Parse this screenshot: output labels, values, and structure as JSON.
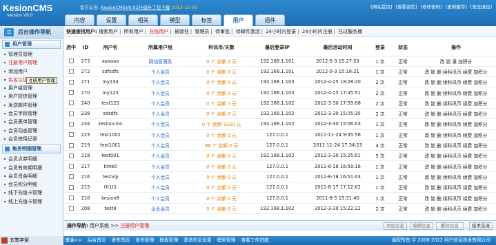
{
  "header": {
    "logo_title": "KesionCMS",
    "logo_version": "version V9.0",
    "notice_prefix": "官方公告:",
    "notice_link": "KesionCMSV9.02升级补丁包下载",
    "notice_date": "2013-12-05",
    "top_links": [
      "[网站首页]",
      "[查看留信]",
      "[修改密码]",
      "[更新缓存]",
      "[安全退出]"
    ]
  },
  "tabs": [
    {
      "label": "内容"
    },
    {
      "label": "设置"
    },
    {
      "label": "相关"
    },
    {
      "label": "模型"
    },
    {
      "label": "标签"
    },
    {
      "label": "用户",
      "active": true
    },
    {
      "label": "插件"
    }
  ],
  "sidebar": {
    "title": "后台操作导航",
    "group1": "用户管理",
    "items1": [
      {
        "label": "管理员管理"
      },
      {
        "label": "注册用户管理",
        "red": true
      },
      {
        "label": "添加用户"
      },
      {
        "label": "实名认证管理",
        "red": true
      },
      {
        "label": "用户组管理"
      },
      {
        "label": "用户短信管理"
      },
      {
        "label": "发送邮件管理"
      },
      {
        "label": "会员字段管理"
      },
      {
        "label": "会员表单管理"
      },
      {
        "label": "会员动态管理"
      },
      {
        "label": "会员使用记录"
      }
    ],
    "group2": "账务明细管理",
    "items2": [
      {
        "label": "会员点券明细"
      },
      {
        "label": "会员有效期明细"
      },
      {
        "label": "会员资金明细"
      },
      {
        "label": "会员积分明细"
      },
      {
        "label": "线下充值卡管理"
      },
      {
        "label": "线上充值卡管理"
      }
    ],
    "tooltip": "注册用户管理"
  },
  "quick": {
    "label": "快速查找用户:",
    "items": [
      {
        "label": "搜索用户"
      },
      {
        "label": "所有用户"
      },
      {
        "label": "在线用户",
        "red": true
      },
      {
        "label": "被锁住"
      },
      {
        "label": "管理员"
      },
      {
        "label": "待审批"
      },
      {
        "label": "待邮件激活"
      },
      {
        "label": "24小时内登录"
      },
      {
        "label": "24小时内注册"
      },
      {
        "label": "已过服务期"
      }
    ]
  },
  "table": {
    "headers": [
      "选中",
      "ID",
      "用户名",
      "所属用户组",
      "科讯币/天数",
      "最后登录IP",
      "最后活动时间",
      "登录",
      "状态",
      "操作"
    ],
    "rows": [
      {
        "id": "273",
        "name": "aaaaaa",
        "group": "网站管理员",
        "coins": "0 个 余额 0 元",
        "ip": "192.168.1.101",
        "time": "2012-5-3 15:27:53",
        "logins": "1 次",
        "status": "正常",
        "ops": "改 锁 隶 加积分"
      },
      {
        "id": "272",
        "name": "sdfsdfs",
        "group": "个人会员",
        "coins": "0 个 余额 0 元",
        "ip": "192.168.1.101",
        "time": "2012-5-3 15:18:21",
        "logins": "1 次",
        "status": "正常",
        "ops": "改 锁 删 续科讯币 续费 加积分"
      },
      {
        "id": "271",
        "name": "my234",
        "group": "个人会员",
        "coins": "0 个 余额 0 元",
        "ip": "192.168.1.103",
        "time": "2012-4-25 18:28:20",
        "logins": "2 次",
        "status": "正常",
        "ops": "改 锁 删 续科讯币 续费 加积分"
      },
      {
        "id": "270",
        "name": "my123",
        "group": "个人会员",
        "coins": "0 个 余额 0 元",
        "ip": "192.168.1.103",
        "time": "2012-4-25 17:45:51",
        "logins": "2 次",
        "status": "正常",
        "ops": "改 锁 删 续科讯币 续费 加积分"
      },
      {
        "id": "240",
        "name": "test123",
        "group": "个人会员",
        "coins": "0 个 余额 0 元",
        "ip": "192.168.1.102",
        "time": "2012-3-30 17:59:08",
        "logins": "2 次",
        "status": "正常",
        "ops": "改 锁 删 续科讯币 续费 加积分"
      },
      {
        "id": "238",
        "name": "sdsdfs",
        "group": "个人会员",
        "coins": "0 个 余额 0 元",
        "ip": "192.168.1.102",
        "time": "2012-3-30 15:05:35",
        "logins": "2 次",
        "status": "正常",
        "ops": "改 锁 删 续科讯币 续费 加积分"
      },
      {
        "id": "234",
        "name": "kesioncms",
        "group": "个人会员",
        "coins": "0 个 余额 3330 元",
        "ip": "192.168.1.102",
        "time": "2012-3-30 15:06:03",
        "logins": "1 次",
        "status": "正常",
        "ops": "改 锁 删 续科讯币 续费 加积分"
      },
      {
        "id": "223",
        "name": "test1002",
        "group": "个人会员",
        "coins": "0 个 余额 0 元",
        "ip": "127.0.0.1",
        "time": "2011-11-24 9:35:56",
        "logins": "1 次",
        "status": "正常",
        "ops": "改 锁 删 续科讯币 续费 加积分"
      },
      {
        "id": "219",
        "name": "test1001",
        "group": "个人会员",
        "coins": "96 个 余额 0 元",
        "ip": "127.0.0.1",
        "time": "2011-11-24 17:34:23",
        "logins": "4 次",
        "status": "正常",
        "ops": "改 锁 删 续科讯币 续费 加积分"
      },
      {
        "id": "218",
        "name": "test001",
        "group": "个人会员",
        "coins": "0 个 余额 0 元",
        "ip": "192.168.1.102",
        "time": "2012-3-30 15:25:01",
        "logins": "5 次",
        "status": "正常",
        "ops": "改 锁 删 续科讯币 续费 加积分"
      },
      {
        "id": "217",
        "name": "time0",
        "group": "个人会员",
        "coins": "0 个 余额 0 元",
        "ip": "127.0.0.1",
        "time": "2011-8-18 16:58:16",
        "logins": "1 次",
        "status": "正常",
        "ops": "改 锁 删 续科讯币 续费 加积分"
      },
      {
        "id": "216",
        "name": "testvip",
        "group": "个人会员",
        "coins": "0 个 余额 0 元",
        "ip": "127.0.0.1",
        "time": "2011-8-18 16:51:03",
        "logins": "1 次",
        "status": "正常",
        "ops": "改 锁 删 续科讯币 续费 加积分"
      },
      {
        "id": "215",
        "name": "tlt1t1",
        "group": "个人会员",
        "coins": "0 个 余额 0 元",
        "ip": "127.0.0.1",
        "time": "2011-8-17 17:12:02",
        "logins": "1 次",
        "status": "正常",
        "ops": "改 锁 删 续科讯币 续费 加积分"
      },
      {
        "id": "210",
        "name": "kesion8",
        "group": "个人会员",
        "coins": "0 个 余额 0 元",
        "ip": "127.0.0.1",
        "time": "2011-8-5 15:31:40",
        "logins": "1 次",
        "status": "正常",
        "ops": "改 锁 删 续科讯币 续费 加积分"
      },
      {
        "id": "208",
        "name": "test8",
        "group": "企业会员",
        "coins": "0 个 余额 0 元",
        "ip": "192.168.1.102",
        "time": "2012-3-30 15:22:22",
        "logins": "2 次",
        "status": "正常",
        "ops": "改 锁 删 续科讯币 续费 加积分"
      }
    ]
  },
  "footbar": {
    "label": "操作导航:",
    "path1": "用户系统",
    "arrow": ">>",
    "path2": "注册用户管理",
    "buttons": [
      "添加信息",
      "编辑信息",
      "删除信息",
      "技术交流"
    ]
  },
  "statusbar": {
    "ime": "五笔字型",
    "links": [
      "速通>>",
      "后台首页",
      "发布首页",
      "发布管理",
      "模板管理",
      "基本信息设置",
      "模型管理",
      "查看工作进度"
    ],
    "copyright": "版权所有 © 2006-2012 科兴信息技术有限公司"
  }
}
